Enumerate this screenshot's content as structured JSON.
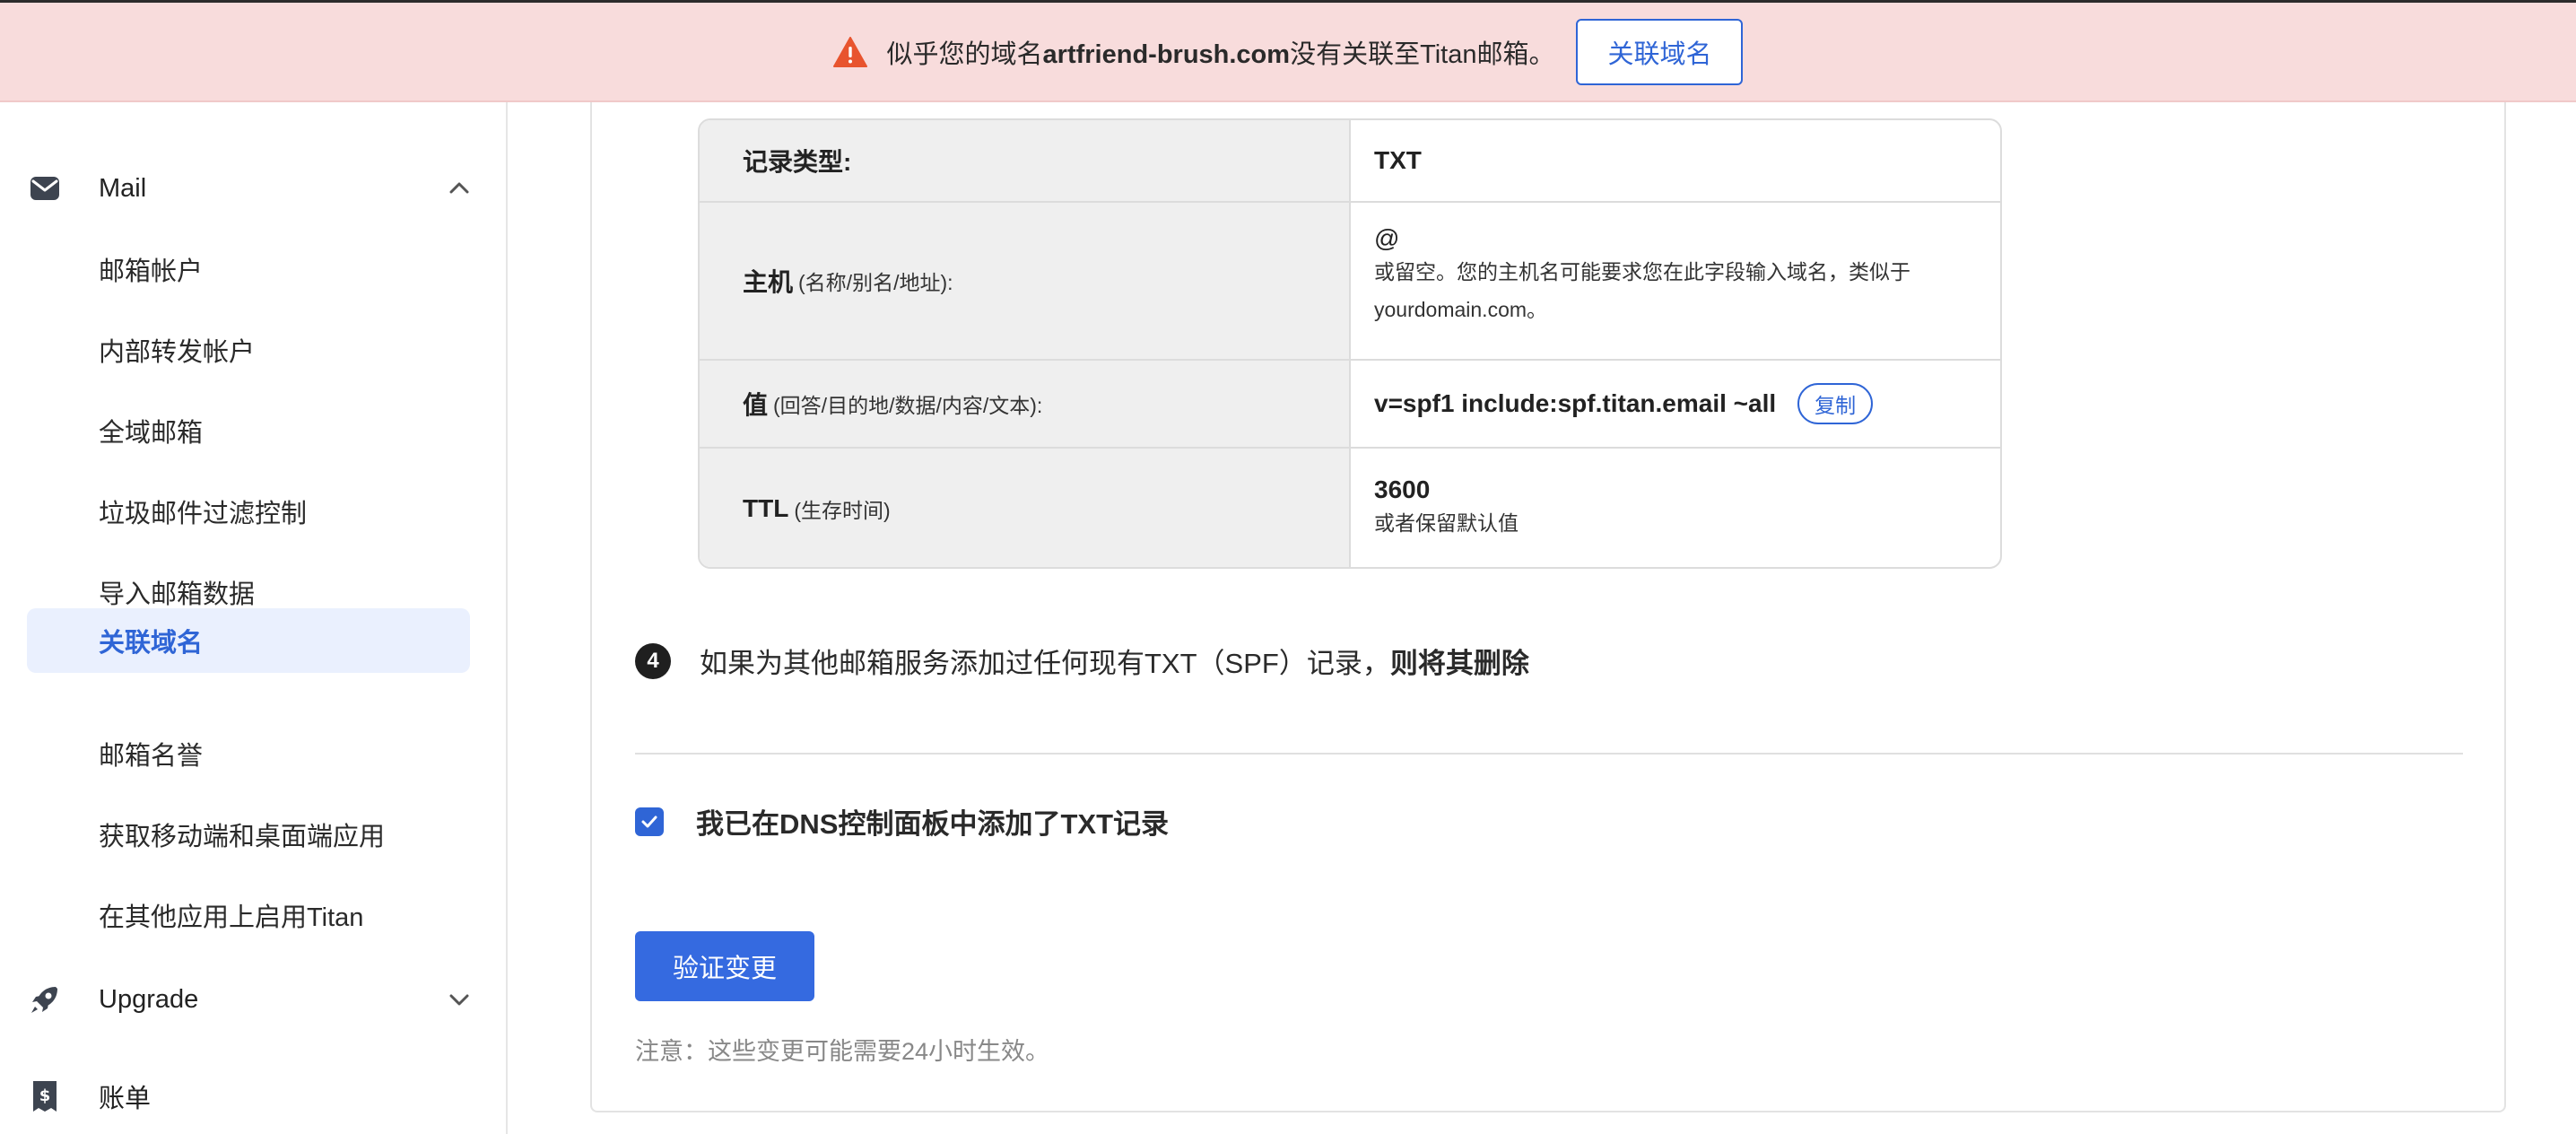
{
  "banner": {
    "message_prefix": "似乎您的域名",
    "domain": "artfriend-brush.com",
    "message_suffix": "没有关联至Titan邮箱。",
    "button_label": "关联域名",
    "icon": "warning-triangle-icon",
    "accent_color": "#e8542e"
  },
  "sidebar": {
    "mail_label": "Mail",
    "mail_items": [
      {
        "label": "邮箱帐户"
      },
      {
        "label": "内部转发帐户"
      },
      {
        "label": "全域邮箱"
      },
      {
        "label": "垃圾邮件过滤控制"
      },
      {
        "label": "导入邮箱数据"
      },
      {
        "label": "关联域名",
        "active": true
      },
      {
        "label": "邮箱名誉"
      },
      {
        "label": "获取移动端和桌面端应用"
      },
      {
        "label": "在其他应用上启用Titan"
      }
    ],
    "upgrade_label": "Upgrade",
    "billing_label": "账单",
    "active_color": "#2f65d6"
  },
  "dns_table": {
    "rows": [
      {
        "key": "记录类型:",
        "hint": "",
        "value": "TXT",
        "sub": ""
      },
      {
        "key": "主机",
        "hint": "(名称/别名/地址):",
        "value": "@",
        "sub": "或留空。您的主机名可能要求您在此字段输入域名，类似于yourdomain.com。"
      },
      {
        "key": "值",
        "hint": "(回答/目的地/数据/内容/文本):",
        "value": "v=spf1 include:spf.titan.email ~all",
        "sub": "",
        "copy_label": "复制"
      },
      {
        "key": "TTL",
        "hint": "(生存时间)",
        "value": "3600",
        "sub": "或者保留默认值"
      }
    ]
  },
  "step4": {
    "number": "4",
    "text": "如果为其他邮箱服务添加过任何现有TXT（SPF）记录，",
    "bold": "则将其删除"
  },
  "confirm": {
    "checked": true,
    "label": "我已在DNS控制面板中添加了TXT记录"
  },
  "verify_button": "验证变更",
  "note": "注意：这些变更可能需要24小时生效。"
}
